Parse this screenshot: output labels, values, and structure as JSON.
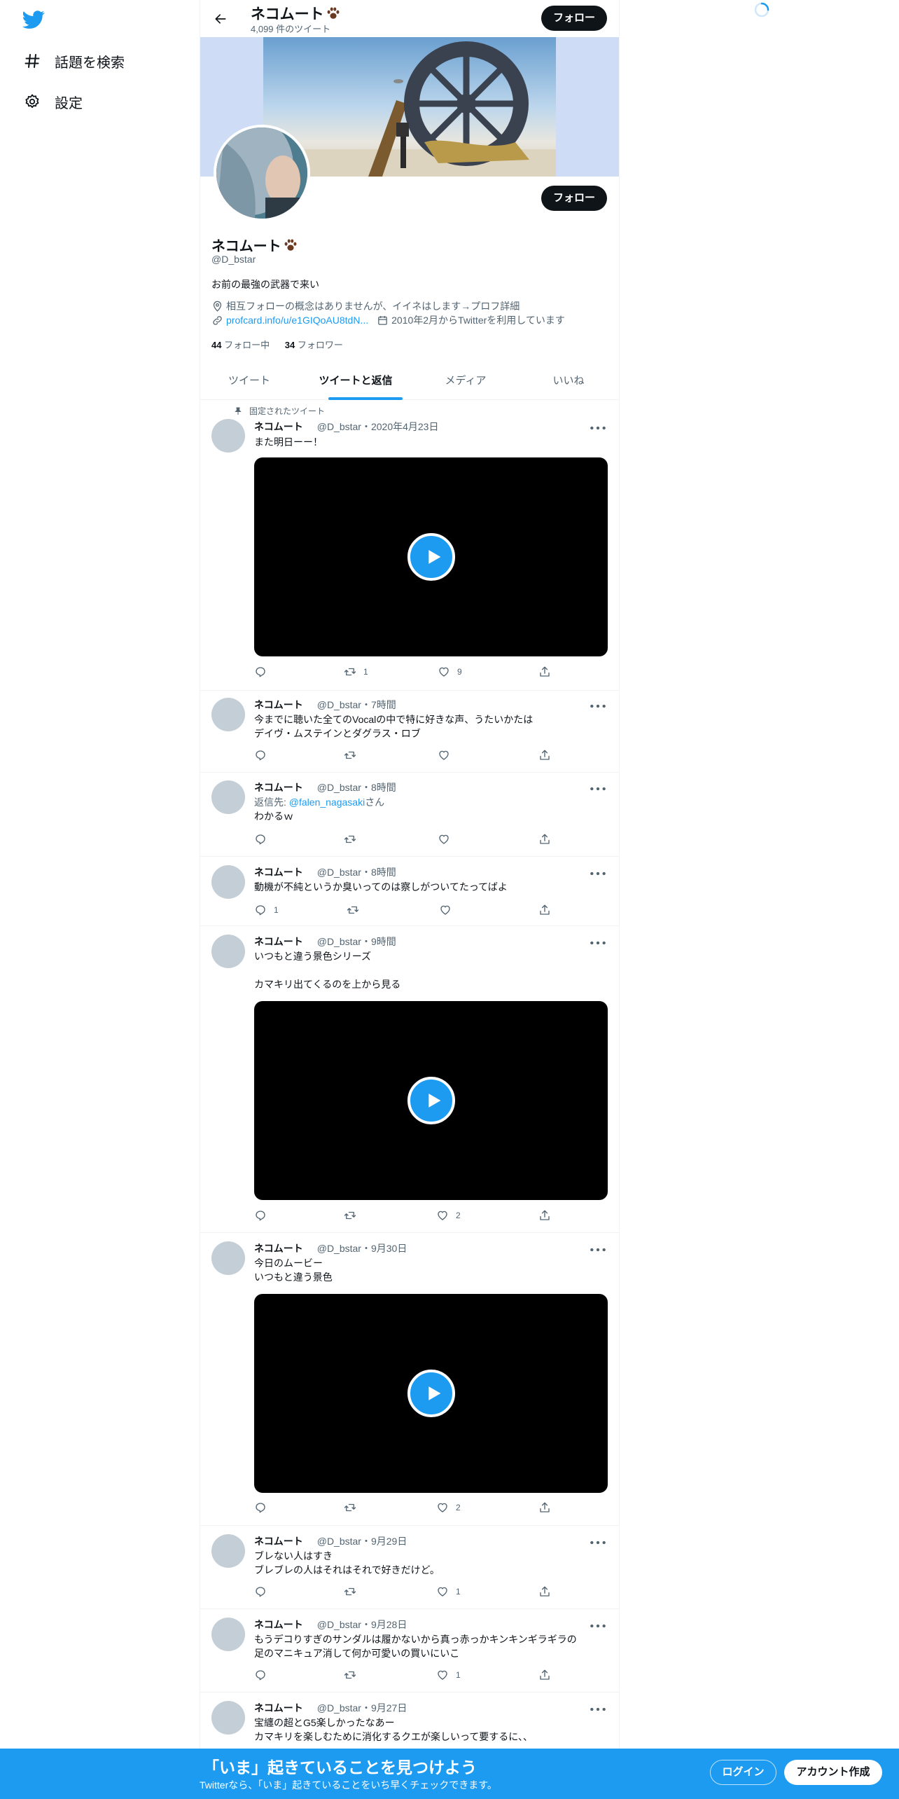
{
  "nav": {
    "explore_label": "話題を検索",
    "settings_label": "設定"
  },
  "profile": {
    "name": "ネコムート",
    "tweet_count": "4,099 件のツイート",
    "follow_label": "フォロー",
    "handle": "@D_bstar",
    "bio": "お前の最強の武器で来い",
    "location": "相互フォローの概念はありませんが、イイネはします→プロフ詳細",
    "url": "profcard.info/u/e1GIQoAU8tdN...",
    "joined": "2010年2月からTwitterを利用しています",
    "following_count": "44",
    "following_label": "フォロー中",
    "followers_count": "34",
    "followers_label": "フォロワー"
  },
  "tabs": [
    {
      "label": "ツイート"
    },
    {
      "label": "ツイートと返信"
    },
    {
      "label": "メディア"
    },
    {
      "label": "いいね"
    }
  ],
  "pinned_label": "固定されたツイート",
  "tweets": [
    {
      "name": "ネコムート",
      "meta": "@D_bstar・2020年4月23日",
      "line1": "また明日ーー！",
      "retweets": "1",
      "likes": "9"
    },
    {
      "name": "ネコムート",
      "meta": "@D_bstar・7時間",
      "line1": "今までに聴いた全てのVocalの中で特に好きな声、うたいかたは",
      "line2": "デイヴ・ムステインとダグラス・ロブ"
    },
    {
      "name": "ネコムート",
      "meta": "@D_bstar・8時間",
      "reply_prefix": "返信先: ",
      "reply_user": "@falen_nagasaki",
      "reply_suffix": "さん",
      "line1": "わかるｗ"
    },
    {
      "name": "ネコムート",
      "meta": "@D_bstar・8時間",
      "line1": "動機が不純というか臭いってのは察しがついてたってばよ",
      "replies": "1"
    },
    {
      "name": "ネコムート",
      "meta": "@D_bstar・9時間",
      "line1": "いつもと違う景色シリーズ",
      "line2": "カマキリ出てくるのを上から見る",
      "likes": "2"
    },
    {
      "name": "ネコムート",
      "meta": "@D_bstar・9月30日",
      "line1": "今日のムービー",
      "line2": "いつもと違う景色",
      "likes": "2"
    },
    {
      "name": "ネコムート",
      "meta": "@D_bstar・9月29日",
      "line1": "ブレない人はすき",
      "line2": "ブレブレの人はそれはそれで好きだけど。",
      "likes": "1"
    },
    {
      "name": "ネコムート",
      "meta": "@D_bstar・9月28日",
      "line1": "もうデコりすぎのサンダルは履かないから真っ赤っかキンキンギラギラの",
      "line2": "足のマニキュア消して何か可愛いの買いにいこ",
      "likes": "1"
    },
    {
      "name": "ネコムート",
      "meta": "@D_bstar・9月27日",
      "line1": "宝纏の超とG5楽しかったなあー",
      "line2": "カマキリを楽しむために消化するクエが楽しいって要するに、、"
    }
  ],
  "bottom": {
    "title": "「いま」起きていることを見つけよう",
    "subtitle": "Twitterなら、「いま」起きていることをいち早くチェックできます。",
    "login": "ログイン",
    "signup": "アカウント作成"
  },
  "colors": {
    "accent": "#1d9bf0",
    "text": "#0f1419",
    "muted": "#536471",
    "button": "#0f1419"
  }
}
